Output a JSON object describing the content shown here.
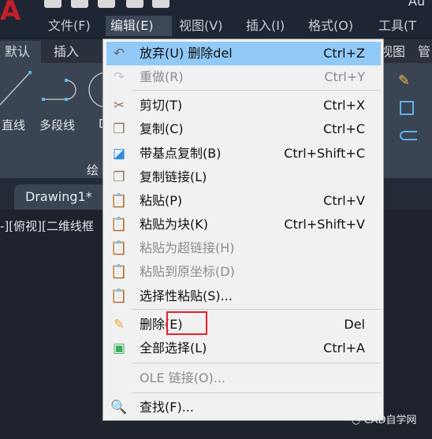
{
  "app": {
    "logo": "A",
    "title_fragment": "Au"
  },
  "menubar": [
    {
      "label": "文件(F)"
    },
    {
      "label": "编辑(E)"
    },
    {
      "label": "视图(V)"
    },
    {
      "label": "插入(I)"
    },
    {
      "label": "格式(O)"
    },
    {
      "label": "工具(T"
    }
  ],
  "ribbon_tabs": [
    {
      "label": "默认"
    },
    {
      "label": "插入"
    },
    {
      "label": "视图"
    },
    {
      "label": "管"
    }
  ],
  "ribbon": {
    "tools": [
      {
        "label": "直线"
      },
      {
        "label": "多段线"
      },
      {
        "label": "D"
      }
    ],
    "panel_label": "绘"
  },
  "document_tab": "Drawing1*",
  "viewport_label": "-][俯视][二维线框",
  "edit_menu": {
    "items": [
      {
        "label": "放弃(U) 删除del",
        "shortcut": "Ctrl+Z",
        "icon": "undo-icon",
        "highlighted": true,
        "enabled": true
      },
      {
        "label": "重做(R)",
        "shortcut": "Ctrl+Y",
        "icon": "redo-icon",
        "enabled": false
      },
      {
        "label": "剪切(T)",
        "shortcut": "Ctrl+X",
        "icon": "cut-icon",
        "enabled": true
      },
      {
        "label": "复制(C)",
        "shortcut": "Ctrl+C",
        "icon": "copy-icon",
        "enabled": true
      },
      {
        "label": "带基点复制(B)",
        "shortcut": "Ctrl+Shift+C",
        "icon": "copy-base-point-icon",
        "enabled": true
      },
      {
        "label": "复制链接(L)",
        "shortcut": "",
        "icon": "copy-link-icon",
        "enabled": true
      },
      {
        "label": "粘贴(P)",
        "shortcut": "Ctrl+V",
        "icon": "paste-icon",
        "enabled": true
      },
      {
        "label": "粘贴为块(K)",
        "shortcut": "Ctrl+Shift+V",
        "icon": "paste-block-icon",
        "enabled": true
      },
      {
        "label": "粘贴为超链接(H)",
        "shortcut": "",
        "icon": "paste-hyperlink-icon",
        "enabled": false
      },
      {
        "label": "粘贴到原坐标(D)",
        "shortcut": "",
        "icon": "paste-original-coords-icon",
        "enabled": false
      },
      {
        "label": "选择性粘贴(S)...",
        "shortcut": "",
        "icon": "paste-special-icon",
        "enabled": true
      },
      {
        "label": "删除(E)",
        "shortcut": "Del",
        "icon": "erase-icon",
        "enabled": true
      },
      {
        "label": "全部选择(L)",
        "shortcut": "Ctrl+A",
        "icon": "select-all-icon",
        "enabled": true
      },
      {
        "label": "OLE 链接(O)...",
        "shortcut": "",
        "icon": "",
        "enabled": false
      },
      {
        "label": "查找(F)...",
        "shortcut": "",
        "icon": "find-icon",
        "enabled": true
      }
    ]
  },
  "annotation_color": "#e8202a",
  "watermark": "CAD自学网"
}
